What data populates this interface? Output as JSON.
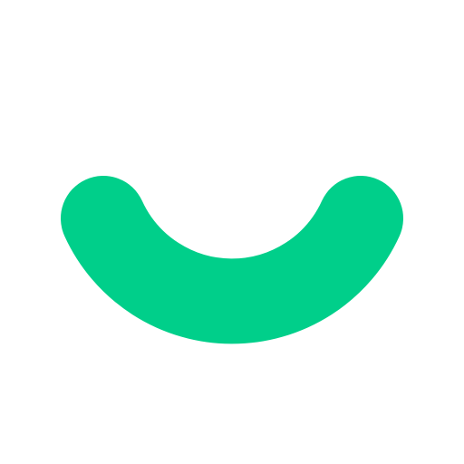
{
  "logo": {
    "icon": "smile-arc-icon",
    "color": "#00CF8A",
    "background": "#FFFFFF"
  }
}
